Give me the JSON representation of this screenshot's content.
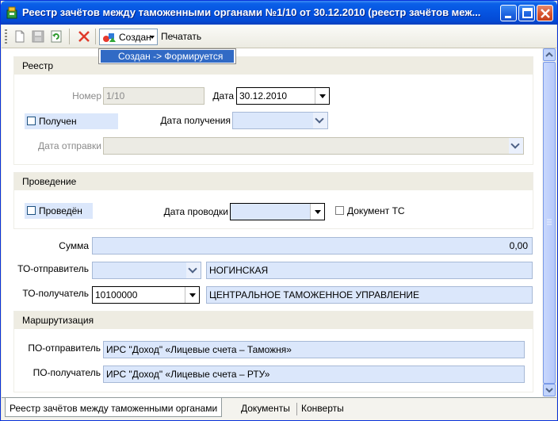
{
  "window": {
    "title": "Реестр зачётов между таможенными органами №1/10 от 30.12.2010 (реестр зачётов меж..."
  },
  "toolbar": {
    "status_label": "Создан",
    "print_label": "Печатать"
  },
  "status_menu": {
    "items": [
      "Создан -> Формируется"
    ]
  },
  "registry": {
    "header": "Реестр",
    "number_label": "Номер",
    "number_value": "1/10",
    "date_label": "Дата",
    "date_value": "30.12.2010",
    "received_label": "Получен",
    "received_date_label": "Дата получения",
    "received_date_value": "",
    "sent_date_label": "Дата отправки",
    "sent_date_value": ""
  },
  "posting": {
    "header": "Проведение",
    "posted_label": "Проведён",
    "posting_date_label": "Дата проводки",
    "posting_date_value": "",
    "ts_doc_label": "Документ ТС"
  },
  "sum": {
    "label": "Сумма",
    "value": "0,00"
  },
  "to_sender": {
    "label": "ТО-отправитель",
    "code": "",
    "name": "НОГИНСКАЯ"
  },
  "to_receiver": {
    "label": "ТО-получатель",
    "code": "10100000",
    "name": "ЦЕНТРАЛЬНОЕ ТАМОЖЕННОЕ УПРАВЛЕНИЕ"
  },
  "routing": {
    "header": "Маршрутизация",
    "po_sender_label": "ПО-отправитель",
    "po_sender_value": "ИРС \"Доход\" «Лицевые счета – Таможня»",
    "po_receiver_label": "ПО-получатель",
    "po_receiver_value": "ИРС \"Доход\" «Лицевые счета – РТУ»"
  },
  "tabs": [
    {
      "label": "Реестр зачётов между таможенными органами"
    },
    {
      "label": "Документы"
    },
    {
      "label": "Конверты"
    }
  ]
}
